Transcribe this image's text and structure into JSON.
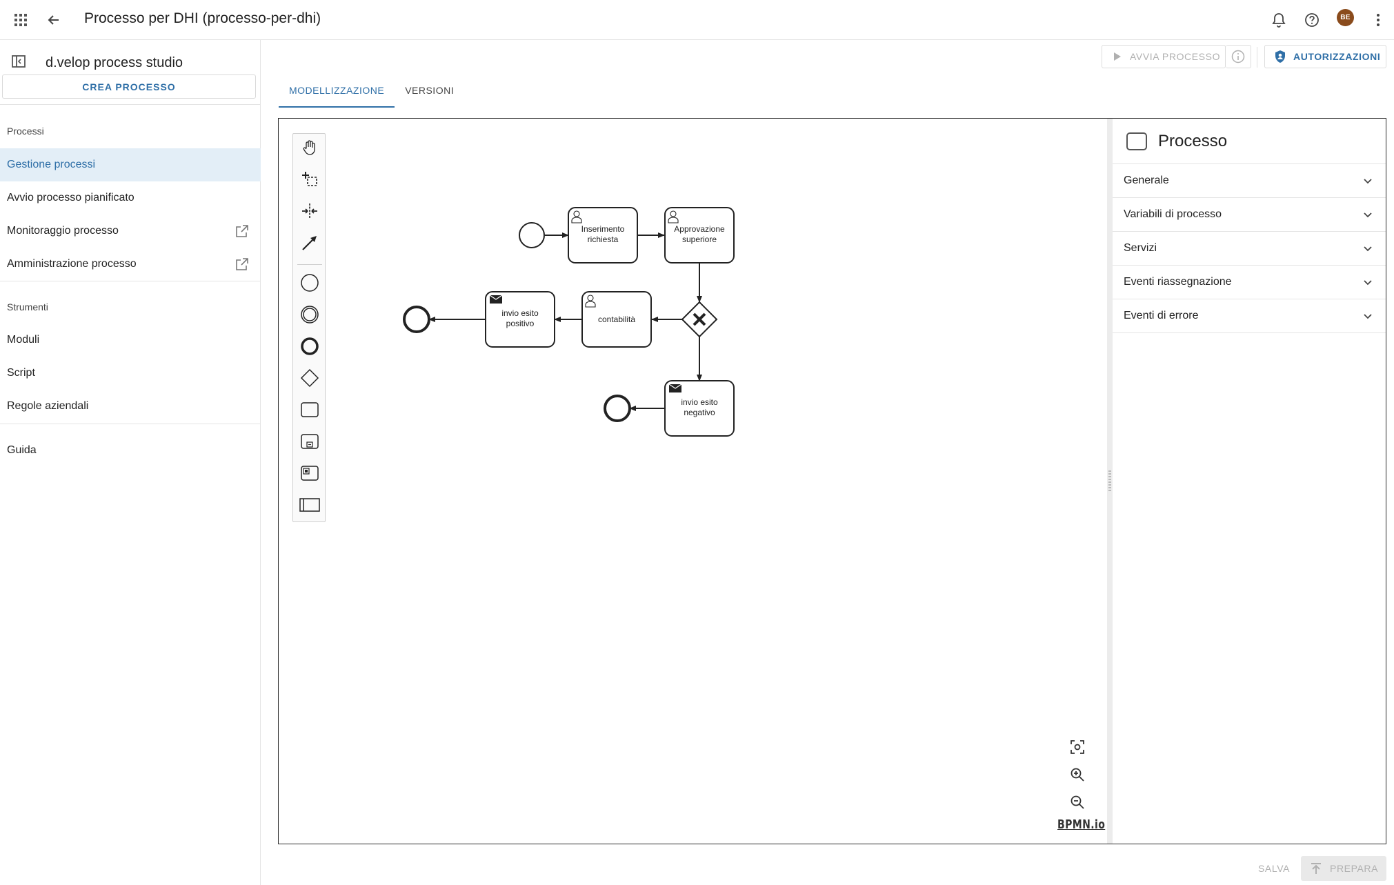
{
  "topbar": {
    "title": "Processo per DHI (processo-per-dhi)",
    "avatar_initials": "BE",
    "icons": [
      "apps-grid-icon",
      "back-arrow-icon",
      "bell-icon",
      "help-icon",
      "more-vert-icon"
    ]
  },
  "sidebar": {
    "app_name": "d.velop process studio",
    "create_label": "CREA PROCESSO",
    "section_processes": "Processi",
    "process_items": [
      {
        "label": "Gestione processi",
        "active": true
      },
      {
        "label": "Avvio processo pianificato"
      },
      {
        "label": "Monitoraggio processo",
        "external": true
      },
      {
        "label": "Amministrazione processo",
        "external": true
      }
    ],
    "section_tools": "Strumenti",
    "tool_items": [
      {
        "label": "Moduli"
      },
      {
        "label": "Script"
      },
      {
        "label": "Regole aziendali"
      }
    ],
    "guide_label": "Guida"
  },
  "actions": {
    "start_label": "AVVIA PROCESSO",
    "permissions_label": "AUTORIZZAZIONI"
  },
  "tabs": [
    {
      "label": "MODELLIZZAZIONE",
      "active": true
    },
    {
      "label": "VERSIONI"
    }
  ],
  "diagram": {
    "tasks": {
      "inserimento_1": "Inserimento",
      "inserimento_2": "richiesta",
      "approvazione_1": "Approvazione",
      "approvazione_2": "superiore",
      "contabilita": "contabilità",
      "positivo_1": "invio esito",
      "positivo_2": "positivo",
      "negativo_1": "invio esito",
      "negativo_2": "negativo"
    },
    "watermark": "BPMN.io"
  },
  "properties": {
    "title": "Processo",
    "sections": [
      {
        "label": "Generale"
      },
      {
        "label": "Variabili di processo"
      },
      {
        "label": "Servizi"
      },
      {
        "label": "Eventi riassegnazione"
      },
      {
        "label": "Eventi di errore"
      }
    ]
  },
  "footer": {
    "save_label": "SALVA",
    "prepare_label": "PREPARA"
  },
  "colors": {
    "accent": "#2f6fa7",
    "active_bg": "#e3eef7",
    "avatar": "#8a4b1c"
  }
}
